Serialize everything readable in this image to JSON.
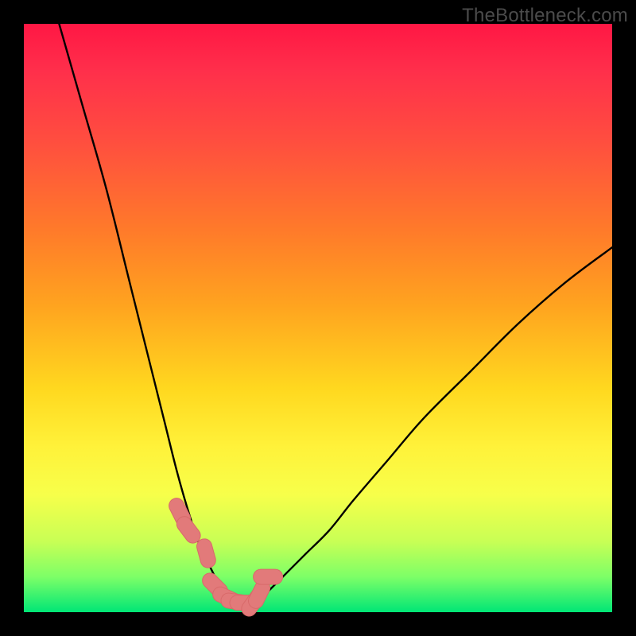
{
  "watermark": "TheBottleneck.com",
  "chart_data": {
    "type": "line",
    "title": "",
    "xlabel": "",
    "ylabel": "",
    "xlim": [
      0,
      100
    ],
    "ylim": [
      0,
      100
    ],
    "grid": false,
    "series": [
      {
        "name": "curve-left",
        "x": [
          6,
          10,
          14,
          18,
          22,
          24,
          26,
          28,
          30,
          31,
          32,
          33,
          34,
          35,
          36,
          38
        ],
        "values": [
          100,
          86,
          72,
          56,
          40,
          32,
          24,
          17,
          11,
          9,
          7,
          5,
          4,
          3,
          2,
          1
        ]
      },
      {
        "name": "curve-right",
        "x": [
          38,
          40,
          42,
          44,
          46,
          48,
          52,
          56,
          62,
          68,
          76,
          84,
          92,
          100
        ],
        "values": [
          1,
          2,
          4,
          6,
          8,
          10,
          14,
          19,
          26,
          33,
          41,
          49,
          56,
          62
        ]
      },
      {
        "name": "markers",
        "x": [
          26.5,
          28.0,
          31.0,
          32.5,
          34.5,
          36.0,
          37.5,
          39.0,
          40.0,
          41.5
        ],
        "values": [
          17.0,
          14.0,
          10.0,
          4.5,
          2.5,
          1.8,
          1.6,
          1.6,
          3.0,
          6.0
        ]
      }
    ],
    "colors": {
      "curve": "#000000",
      "marker_fill": "#e27a7a",
      "marker_stroke": "#d86a6a"
    }
  }
}
